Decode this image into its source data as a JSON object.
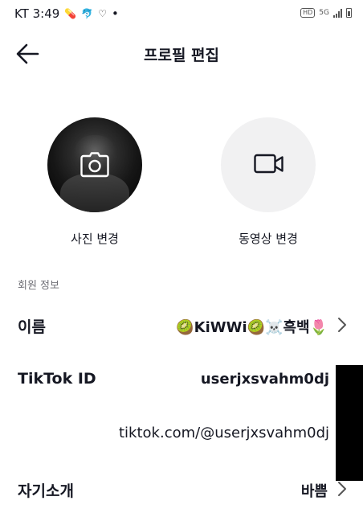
{
  "status_bar": {
    "carrier_time": "KT 3:49",
    "dot": "•",
    "hd": "HD",
    "network": "5G"
  },
  "header": {
    "title": "프로필 편집"
  },
  "media": {
    "photo_label": "사진 변경",
    "video_label": "동영상 변경"
  },
  "section": {
    "label": "회원 정보"
  },
  "fields": {
    "name_label": "이름",
    "name_value": "🥝KiWWi🥝☠️흑백🌷",
    "id_label": "TikTok ID",
    "id_value": "userjxsvahm0dj",
    "link_value": "tiktok.com/@userjxsvahm0dj",
    "bio_label": "자기소개",
    "bio_value": "바쁨"
  },
  "icons": {
    "back": "arrow-left-icon",
    "camera": "camera-icon",
    "video": "video-camera-icon",
    "chevron": "chevron-right-icon"
  }
}
